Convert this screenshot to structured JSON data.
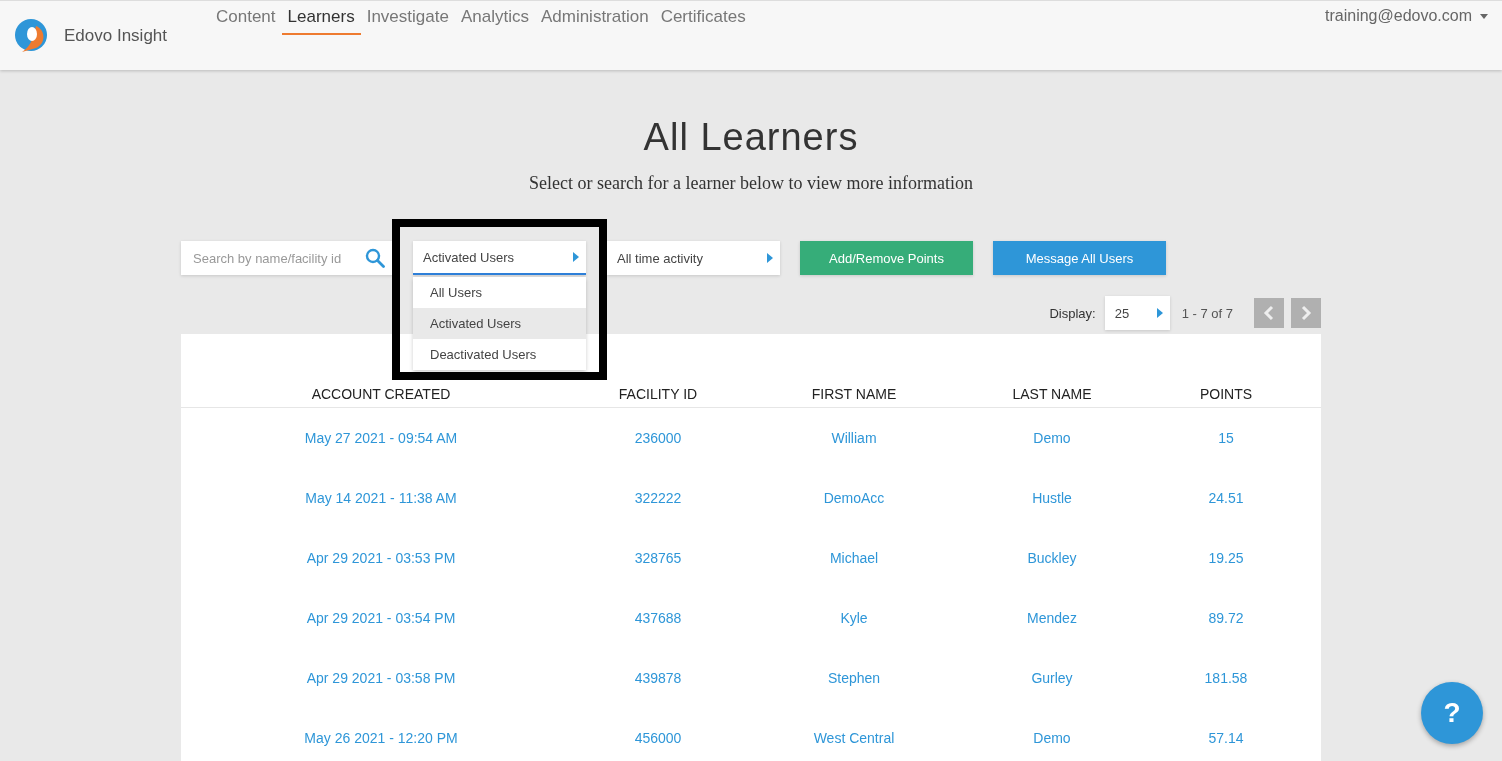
{
  "brand": {
    "name": "Edovo Insight"
  },
  "nav": [
    {
      "label": "Content",
      "selected": false
    },
    {
      "label": "Learners",
      "selected": true
    },
    {
      "label": "Investigate",
      "selected": false
    },
    {
      "label": "Analytics",
      "selected": false
    },
    {
      "label": "Administration",
      "selected": false
    },
    {
      "label": "Certificates",
      "selected": false
    }
  ],
  "user_menu": "training@edovo.com",
  "title": "All Learners",
  "subtitle": "Select or search for a learner below to view more information",
  "search": {
    "placeholder": "Search by name/facility id"
  },
  "status_filter": {
    "value": "Activated Users",
    "options": [
      {
        "label": "All Users",
        "selected": false
      },
      {
        "label": "Activated Users",
        "selected": true
      },
      {
        "label": "Deactivated Users",
        "selected": false
      }
    ]
  },
  "activity_filter": {
    "value": "All time activity"
  },
  "buttons": [
    {
      "label": "Add/Remove Points",
      "kind": "green"
    },
    {
      "label": "Message All Users",
      "kind": "blue"
    }
  ],
  "pagination": {
    "display_label": "Display:",
    "page_size": "25",
    "range": "1 - 7 of 7"
  },
  "table": {
    "columns": [
      "ACCOUNT CREATED",
      "FACILITY ID",
      "FIRST NAME",
      "LAST NAME",
      "POINTS"
    ],
    "rows": [
      [
        "May 27 2021 - 09:54 AM",
        "236000",
        "William",
        "Demo",
        "15"
      ],
      [
        "May 14 2021 - 11:38 AM",
        "322222",
        "DemoAcc",
        "Hustle",
        "24.51"
      ],
      [
        "Apr 29 2021 - 03:53 PM",
        "328765",
        "Michael",
        "Buckley",
        "19.25"
      ],
      [
        "Apr 29 2021 - 03:54 PM",
        "437688",
        "Kyle",
        "Mendez",
        "89.72"
      ],
      [
        "Apr 29 2021 - 03:58 PM",
        "439878",
        "Stephen",
        "Gurley",
        "181.58"
      ],
      [
        "May 26 2021 - 12:20 PM",
        "456000",
        "West Central",
        "Demo",
        "57.14"
      ]
    ]
  },
  "help_button": "?"
}
